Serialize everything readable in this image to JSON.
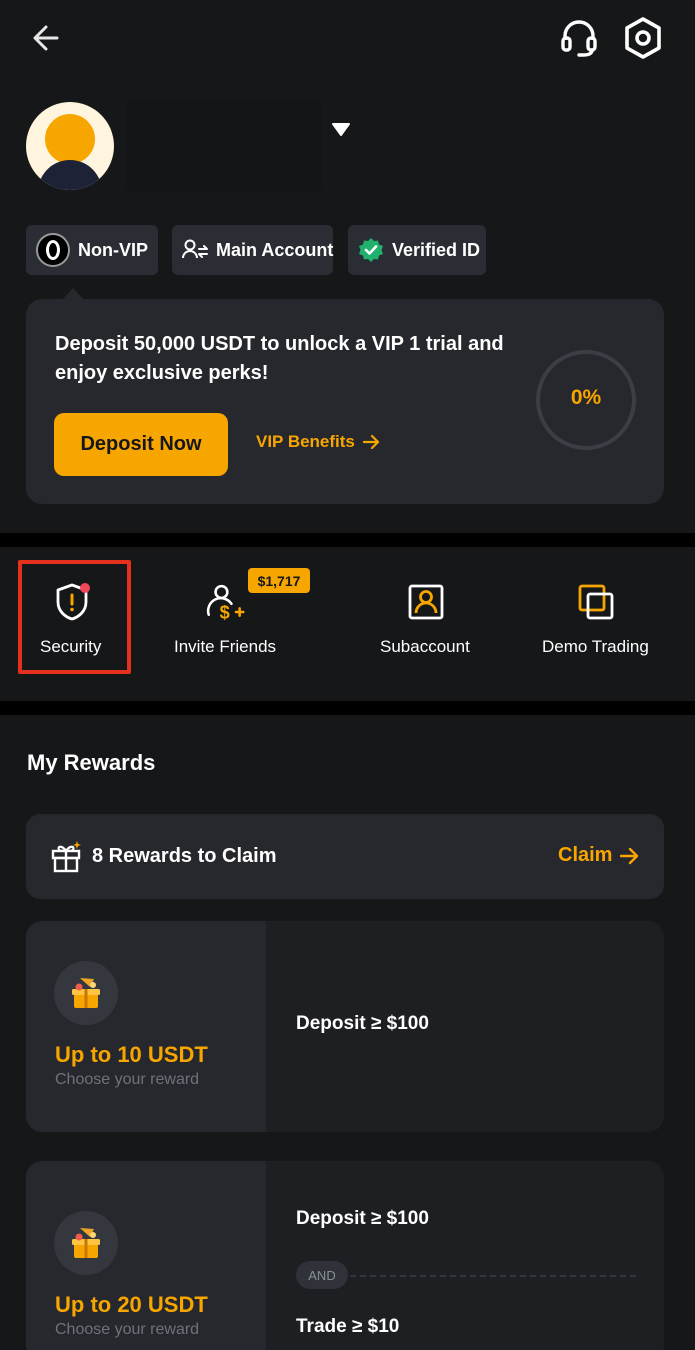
{
  "header": {
    "back_icon": "arrow-left-icon",
    "support_icon": "headset-icon",
    "settings_icon": "settings-hexagon-icon"
  },
  "profile": {
    "avatar_icon": "user-avatar",
    "chips": {
      "vip": "Non-VIP",
      "account": "Main Account",
      "verified": "Verified ID"
    }
  },
  "vip_card": {
    "message": "Deposit 50,000 USDT to unlock a VIP 1 trial and enjoy exclusive perks!",
    "deposit_button": "Deposit Now",
    "benefits_link": "VIP Benefits",
    "progress_label": "0%",
    "progress": 0
  },
  "quick_actions": {
    "security": "Security",
    "invite": "Invite Friends",
    "invite_badge": "$1,717",
    "subaccount": "Subaccount",
    "demo": "Demo Trading"
  },
  "rewards": {
    "title": "My Rewards",
    "claim_text": "8 Rewards to Claim",
    "claim_link": "Claim",
    "cards": [
      {
        "amount": "Up to 10 USDT",
        "subtitle": "Choose your reward",
        "conditions": [
          "Deposit ≥ $100"
        ]
      },
      {
        "amount": "Up to 20 USDT",
        "subtitle": "Choose your reward",
        "conditions": [
          "Deposit ≥ $100",
          "Trade ≥ $10"
        ],
        "joiner": "AND"
      }
    ]
  },
  "colors": {
    "accent": "#f7a600",
    "background": "#161719",
    "card": "#26282d",
    "verified": "#20b26c",
    "alert": "#f0475a"
  }
}
